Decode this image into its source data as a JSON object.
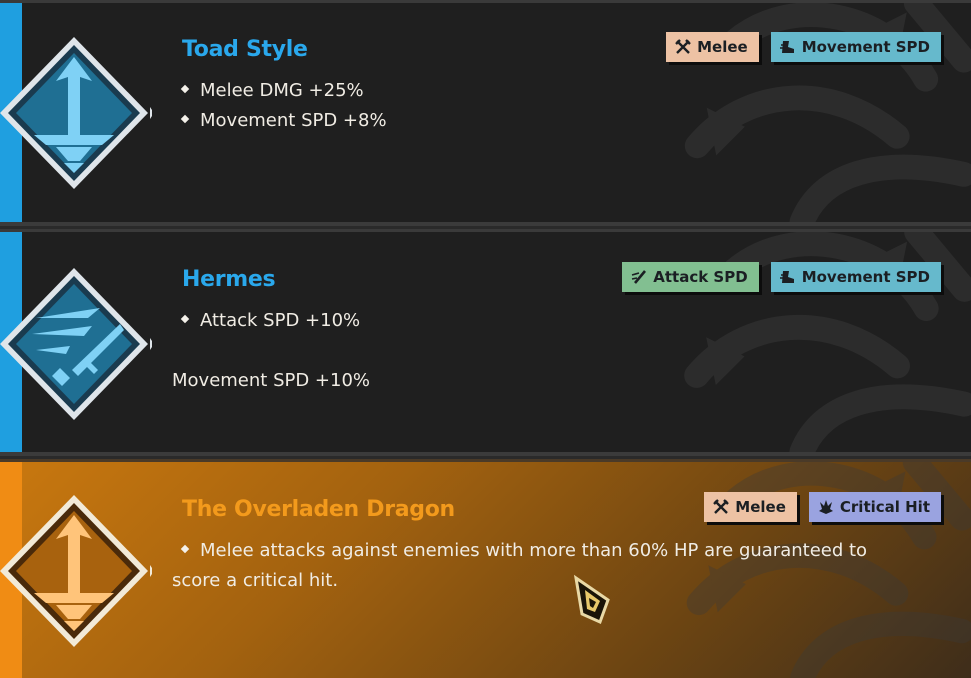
{
  "cards": [
    {
      "title": "Toad Style",
      "emblem": "sword-down-icon",
      "bullets": [
        "Melee DMG +25%",
        "Movement SPD +8%"
      ],
      "tags": [
        {
          "label": "Melee",
          "icon": "crossed-swords-icon",
          "color": "#edc2a4"
        },
        {
          "label": "Movement SPD",
          "icon": "boot-icon",
          "color": "#66b9cc"
        }
      ],
      "selected": false
    },
    {
      "title": "Hermes",
      "emblem": "swift-sword-icon",
      "bullets": [
        "Attack SPD +10%"
      ],
      "extra_line": "Movement SPD +10%",
      "tags": [
        {
          "label": "Attack SPD",
          "icon": "speed-slash-icon",
          "color": "#82bf91"
        },
        {
          "label": "Movement SPD",
          "icon": "boot-icon",
          "color": "#66b9cc"
        }
      ],
      "selected": false
    },
    {
      "title": "The Overladen Dragon",
      "emblem": "sword-down-icon",
      "bullets": [
        "Melee attacks against enemies with more than 60% HP are guaranteed to score a critical hit."
      ],
      "tags": [
        {
          "label": "Melee",
          "icon": "crossed-swords-icon",
          "color": "#edc2a4"
        },
        {
          "label": "Critical Hit",
          "icon": "claw-icon",
          "color": "#9aa3e0"
        }
      ],
      "selected": true
    }
  ],
  "colors": {
    "accent_blue": "#1f9fe0",
    "accent_orange": "#f08c14"
  }
}
